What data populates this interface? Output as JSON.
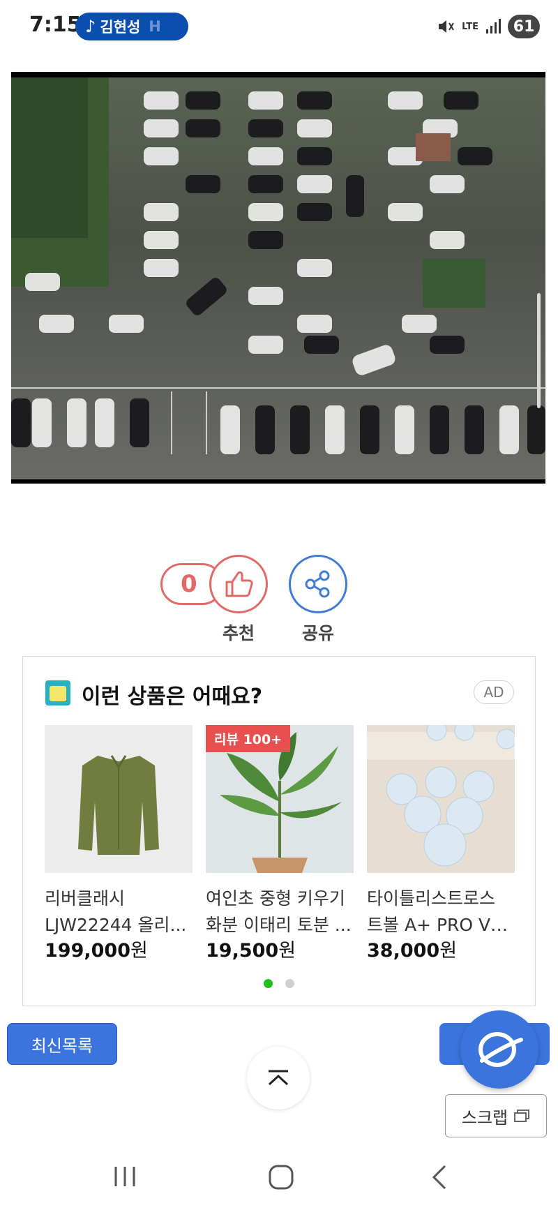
{
  "status": {
    "time": "7:15",
    "media_text": "김현성",
    "media_fade": "H",
    "lte": "LTE",
    "battery": "61"
  },
  "reaction": {
    "like_count": "0",
    "like_label": "추천",
    "share_label": "공유"
  },
  "ad": {
    "title": "이런 상품은 어때요?",
    "badge": "AD",
    "products": [
      {
        "name_line1": "리버클래시",
        "name_line2": "LJW22244 올리...",
        "price": "199,000",
        "unit": "원"
      },
      {
        "name_line1": "여인초 중형 키우기",
        "name_line2": "화분 이태리 토분 ...",
        "price": "19,500",
        "unit": "원",
        "tag": "리뷰 100+"
      },
      {
        "name_line1": "타이틀리스트로스",
        "name_line2": "트볼 A+ PRO V1...",
        "price": "38,000",
        "unit": "원"
      }
    ],
    "page_dots": 2,
    "active_dot": 1
  },
  "bottom": {
    "latest_label": "최신목록",
    "scrap_label": "스크랩"
  },
  "colors": {
    "accent_blue": "#3b74dd",
    "like_red": "#e26a66",
    "share_blue": "#3f7bd8",
    "dot_active": "#1ec01e"
  }
}
